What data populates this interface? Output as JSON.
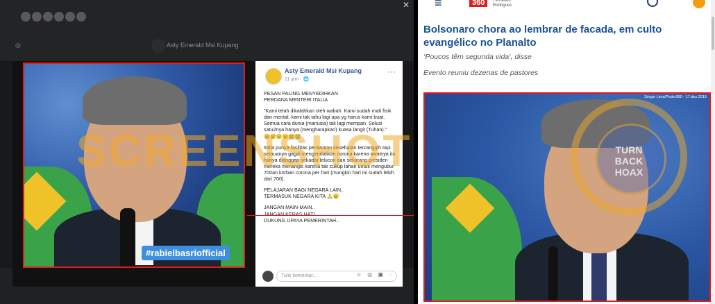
{
  "facebook": {
    "post": {
      "author": "Asty Emerald Msi Kupang",
      "time": "11 jam · 🌐",
      "more": "···",
      "paragraphs": [
        "PESAN PALING MENYEDIHKAN\nPERDANA MENTERI ITALIA",
        "\"Kami telah dikalahkan oleh wabah. Kami sudah mati fisik dan mental, kami tak tahu lagi apa yg harus kami buat. Semua cara dunia (manusia) tak lagi mempan. Solusi satu2nya hanya (mengharapkan) kuasa langit (Tuhan).\"\n😢😢😢😢😭😭",
        "Italia punya fasilitas perawatan kesehatan tercanggih tapi semuanya gagal mengendalikan corona karena awalnya itu hanya dianggap sekadar lelucon dan sekarang presiden mereka menangis karena tak cukup lahan untuk mengubur 700an korban corona per hari (mungkin hari ini sudah lebih dari 700).",
        "PELAJARAN BAGI NEGARA LAIN..\nTERMASUK NEGARA KITA 🙏😢",
        "JANGAN MAIN-MAIN..\nJANGAN KERAS HATI..\nDUKUNG UPAYA PEMERINTAH.."
      ],
      "comment_placeholder": "Tulis komentar...",
      "comment_icons": "☺ ◎ ▣ ◌"
    },
    "photo_tag": "#rabielbasriofficial",
    "blurred_author": "Asty Emerald Msi Kupang"
  },
  "news": {
    "logo": "360",
    "logo_sub": "Fernando\nRodrigues",
    "headline": "Bolsonaro chora ao lembrar de facada, em culto evangélico no Planalto",
    "subtitle1": "‘Poucos têm segunda vida’, disse",
    "subtitle2": "Evento reuniu dezenas de pastores",
    "photo_credit": "Sérgio Lima/Poder360 - 17.dez.2019"
  },
  "watermark": {
    "text": "SCREENSHOT",
    "seal": "TURN\nBACK\nHOAX"
  },
  "colors": {
    "highlight": "#e21b1b",
    "news_blue": "#1a5296",
    "fb_link": "#385898"
  }
}
